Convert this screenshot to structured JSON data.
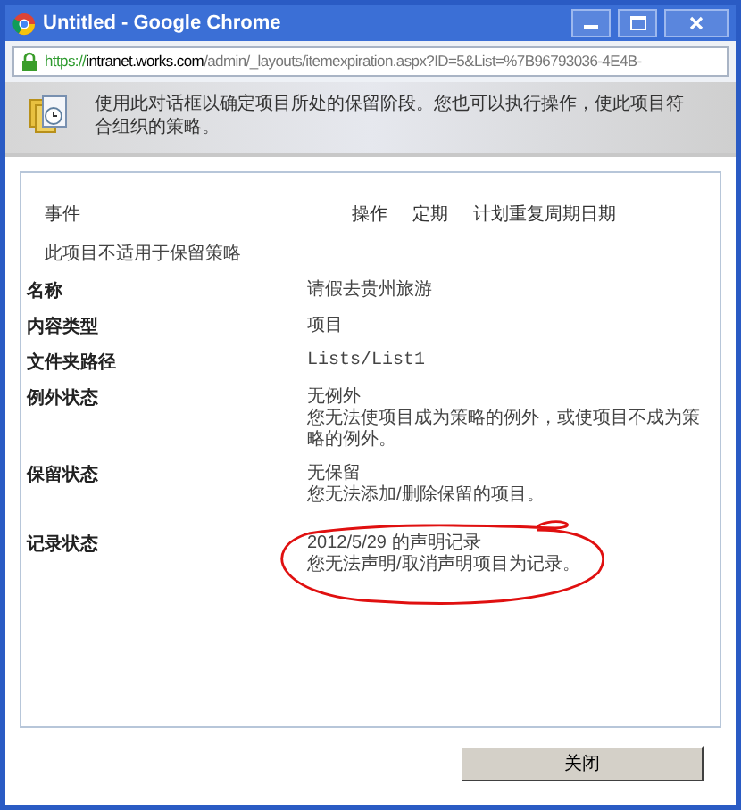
{
  "window": {
    "title": "Untitled - Google Chrome"
  },
  "address_bar": {
    "scheme": "https://",
    "host": "intranet.works.com",
    "path": "/admin/_layouts/itemexpiration.aspx?ID=5&List=%7B96793036-4E4B-"
  },
  "header": {
    "description": "使用此对话框以确定项目所处的保留阶段。您也可以执行操作，使此项目符合组织的策略。"
  },
  "events": {
    "columns": [
      "事件",
      "操作",
      "定期",
      "计划重复周期日期"
    ],
    "note": "此项目不适用于保留策略"
  },
  "properties": [
    {
      "label": "名称",
      "lines": [
        "请假去贵州旅游"
      ],
      "kind": "text"
    },
    {
      "label": "内容类型",
      "lines": [
        "项目"
      ],
      "kind": "text"
    },
    {
      "label": "文件夹路径",
      "lines": [
        "Lists/List1"
      ],
      "kind": "mono"
    },
    {
      "label": "例外状态",
      "lines": [
        "无例外",
        "您无法使项目成为策略的例外，或使项目不成为策略的例外。"
      ],
      "kind": "text"
    },
    {
      "label": "保留状态",
      "lines": [
        "无保留",
        "您无法添加/删除保留的项目。"
      ],
      "kind": "text"
    },
    {
      "label": "记录状态",
      "lines": [
        "2012/5/29 的声明记录",
        "您无法声明/取消声明项目为记录。"
      ],
      "kind": "text",
      "circled": true
    }
  ],
  "buttons": [
    "关闭"
  ]
}
